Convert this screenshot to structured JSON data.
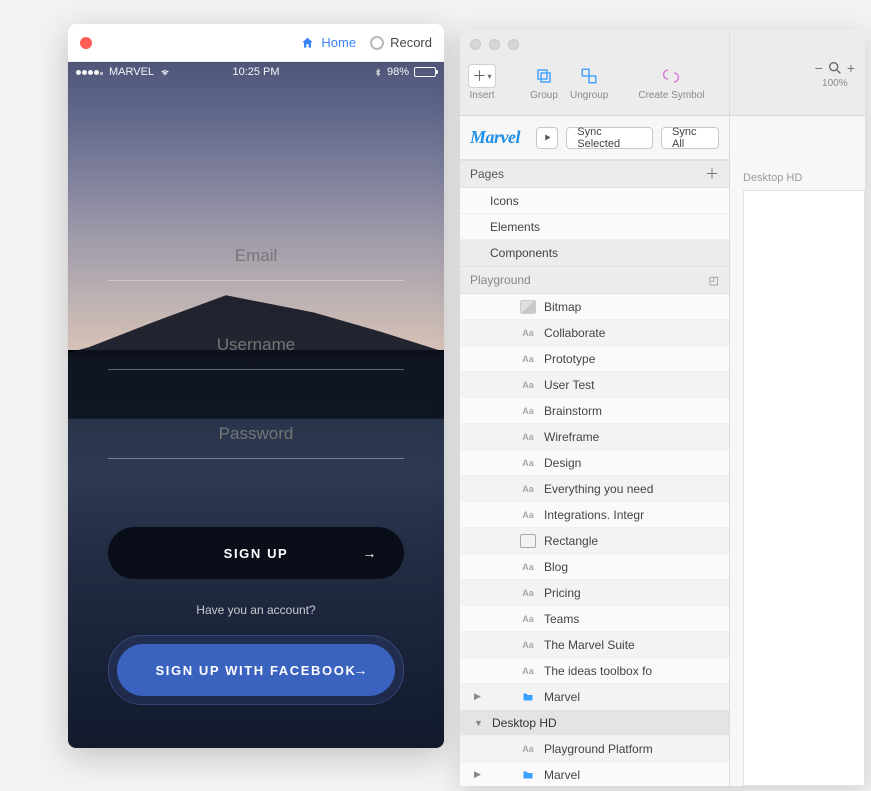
{
  "mobile_window": {
    "home_label": "Home",
    "record_label": "Record"
  },
  "statusbar": {
    "carrier": "MARVEL",
    "time": "10:25 PM",
    "battery_pct": "98%"
  },
  "form": {
    "email_placeholder": "Email",
    "username_placeholder": "Username",
    "password_placeholder": "Password",
    "signup_label": "SIGN UP",
    "have_account_text": "Have you an account?",
    "facebook_label": "SIGN UP WITH FACEBOOK"
  },
  "toolbar": {
    "insert": "Insert",
    "group": "Group",
    "ungroup": "Ungroup",
    "create_symbol": "Create Symbol",
    "zoom_pct": "100%"
  },
  "plugin": {
    "logo": "Marvel",
    "sync_selected": "Sync Selected",
    "sync_all": "Sync All"
  },
  "pages": {
    "header": "Pages",
    "items": [
      "Icons",
      "Elements",
      "Components"
    ]
  },
  "artboard_section": {
    "header": "Playground"
  },
  "layers": [
    {
      "kind": "bitmap",
      "label": "Bitmap"
    },
    {
      "kind": "text",
      "label": "Collaborate"
    },
    {
      "kind": "text",
      "label": "Prototype"
    },
    {
      "kind": "text",
      "label": "User Test"
    },
    {
      "kind": "text",
      "label": "Brainstorm"
    },
    {
      "kind": "text",
      "label": "Wireframe"
    },
    {
      "kind": "text",
      "label": "Design"
    },
    {
      "kind": "text",
      "label": "Everything you need"
    },
    {
      "kind": "text",
      "label": "Integrations. Integr"
    },
    {
      "kind": "rect",
      "label": "Rectangle"
    },
    {
      "kind": "text",
      "label": "Blog"
    },
    {
      "kind": "text",
      "label": "Pricing"
    },
    {
      "kind": "text",
      "label": "Teams"
    },
    {
      "kind": "text",
      "label": "The Marvel Suite"
    },
    {
      "kind": "text",
      "label": "The ideas toolbox fo"
    },
    {
      "kind": "folder",
      "label": "Marvel",
      "disclose": true
    }
  ],
  "group2": {
    "header": "Desktop HD",
    "items": [
      {
        "kind": "text",
        "label": "Playground Platform"
      },
      {
        "kind": "folder",
        "label": "Marvel",
        "disclose": true
      }
    ]
  },
  "canvas": {
    "artboard_name": "Desktop HD"
  }
}
